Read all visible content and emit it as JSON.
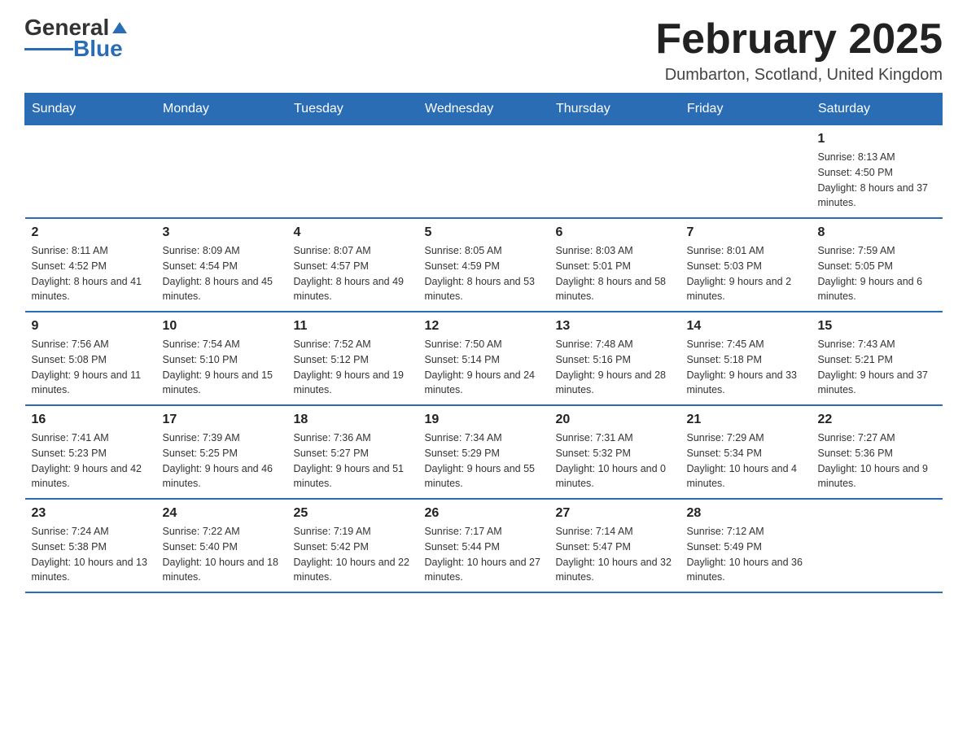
{
  "logo": {
    "text_general": "General",
    "text_blue": "Blue"
  },
  "title": "February 2025",
  "location": "Dumbarton, Scotland, United Kingdom",
  "days_of_week": [
    "Sunday",
    "Monday",
    "Tuesday",
    "Wednesday",
    "Thursday",
    "Friday",
    "Saturday"
  ],
  "weeks": [
    [
      {
        "day": "",
        "info": ""
      },
      {
        "day": "",
        "info": ""
      },
      {
        "day": "",
        "info": ""
      },
      {
        "day": "",
        "info": ""
      },
      {
        "day": "",
        "info": ""
      },
      {
        "day": "",
        "info": ""
      },
      {
        "day": "1",
        "info": "Sunrise: 8:13 AM\nSunset: 4:50 PM\nDaylight: 8 hours and 37 minutes."
      }
    ],
    [
      {
        "day": "2",
        "info": "Sunrise: 8:11 AM\nSunset: 4:52 PM\nDaylight: 8 hours and 41 minutes."
      },
      {
        "day": "3",
        "info": "Sunrise: 8:09 AM\nSunset: 4:54 PM\nDaylight: 8 hours and 45 minutes."
      },
      {
        "day": "4",
        "info": "Sunrise: 8:07 AM\nSunset: 4:57 PM\nDaylight: 8 hours and 49 minutes."
      },
      {
        "day": "5",
        "info": "Sunrise: 8:05 AM\nSunset: 4:59 PM\nDaylight: 8 hours and 53 minutes."
      },
      {
        "day": "6",
        "info": "Sunrise: 8:03 AM\nSunset: 5:01 PM\nDaylight: 8 hours and 58 minutes."
      },
      {
        "day": "7",
        "info": "Sunrise: 8:01 AM\nSunset: 5:03 PM\nDaylight: 9 hours and 2 minutes."
      },
      {
        "day": "8",
        "info": "Sunrise: 7:59 AM\nSunset: 5:05 PM\nDaylight: 9 hours and 6 minutes."
      }
    ],
    [
      {
        "day": "9",
        "info": "Sunrise: 7:56 AM\nSunset: 5:08 PM\nDaylight: 9 hours and 11 minutes."
      },
      {
        "day": "10",
        "info": "Sunrise: 7:54 AM\nSunset: 5:10 PM\nDaylight: 9 hours and 15 minutes."
      },
      {
        "day": "11",
        "info": "Sunrise: 7:52 AM\nSunset: 5:12 PM\nDaylight: 9 hours and 19 minutes."
      },
      {
        "day": "12",
        "info": "Sunrise: 7:50 AM\nSunset: 5:14 PM\nDaylight: 9 hours and 24 minutes."
      },
      {
        "day": "13",
        "info": "Sunrise: 7:48 AM\nSunset: 5:16 PM\nDaylight: 9 hours and 28 minutes."
      },
      {
        "day": "14",
        "info": "Sunrise: 7:45 AM\nSunset: 5:18 PM\nDaylight: 9 hours and 33 minutes."
      },
      {
        "day": "15",
        "info": "Sunrise: 7:43 AM\nSunset: 5:21 PM\nDaylight: 9 hours and 37 minutes."
      }
    ],
    [
      {
        "day": "16",
        "info": "Sunrise: 7:41 AM\nSunset: 5:23 PM\nDaylight: 9 hours and 42 minutes."
      },
      {
        "day": "17",
        "info": "Sunrise: 7:39 AM\nSunset: 5:25 PM\nDaylight: 9 hours and 46 minutes."
      },
      {
        "day": "18",
        "info": "Sunrise: 7:36 AM\nSunset: 5:27 PM\nDaylight: 9 hours and 51 minutes."
      },
      {
        "day": "19",
        "info": "Sunrise: 7:34 AM\nSunset: 5:29 PM\nDaylight: 9 hours and 55 minutes."
      },
      {
        "day": "20",
        "info": "Sunrise: 7:31 AM\nSunset: 5:32 PM\nDaylight: 10 hours and 0 minutes."
      },
      {
        "day": "21",
        "info": "Sunrise: 7:29 AM\nSunset: 5:34 PM\nDaylight: 10 hours and 4 minutes."
      },
      {
        "day": "22",
        "info": "Sunrise: 7:27 AM\nSunset: 5:36 PM\nDaylight: 10 hours and 9 minutes."
      }
    ],
    [
      {
        "day": "23",
        "info": "Sunrise: 7:24 AM\nSunset: 5:38 PM\nDaylight: 10 hours and 13 minutes."
      },
      {
        "day": "24",
        "info": "Sunrise: 7:22 AM\nSunset: 5:40 PM\nDaylight: 10 hours and 18 minutes."
      },
      {
        "day": "25",
        "info": "Sunrise: 7:19 AM\nSunset: 5:42 PM\nDaylight: 10 hours and 22 minutes."
      },
      {
        "day": "26",
        "info": "Sunrise: 7:17 AM\nSunset: 5:44 PM\nDaylight: 10 hours and 27 minutes."
      },
      {
        "day": "27",
        "info": "Sunrise: 7:14 AM\nSunset: 5:47 PM\nDaylight: 10 hours and 32 minutes."
      },
      {
        "day": "28",
        "info": "Sunrise: 7:12 AM\nSunset: 5:49 PM\nDaylight: 10 hours and 36 minutes."
      },
      {
        "day": "",
        "info": ""
      }
    ]
  ]
}
